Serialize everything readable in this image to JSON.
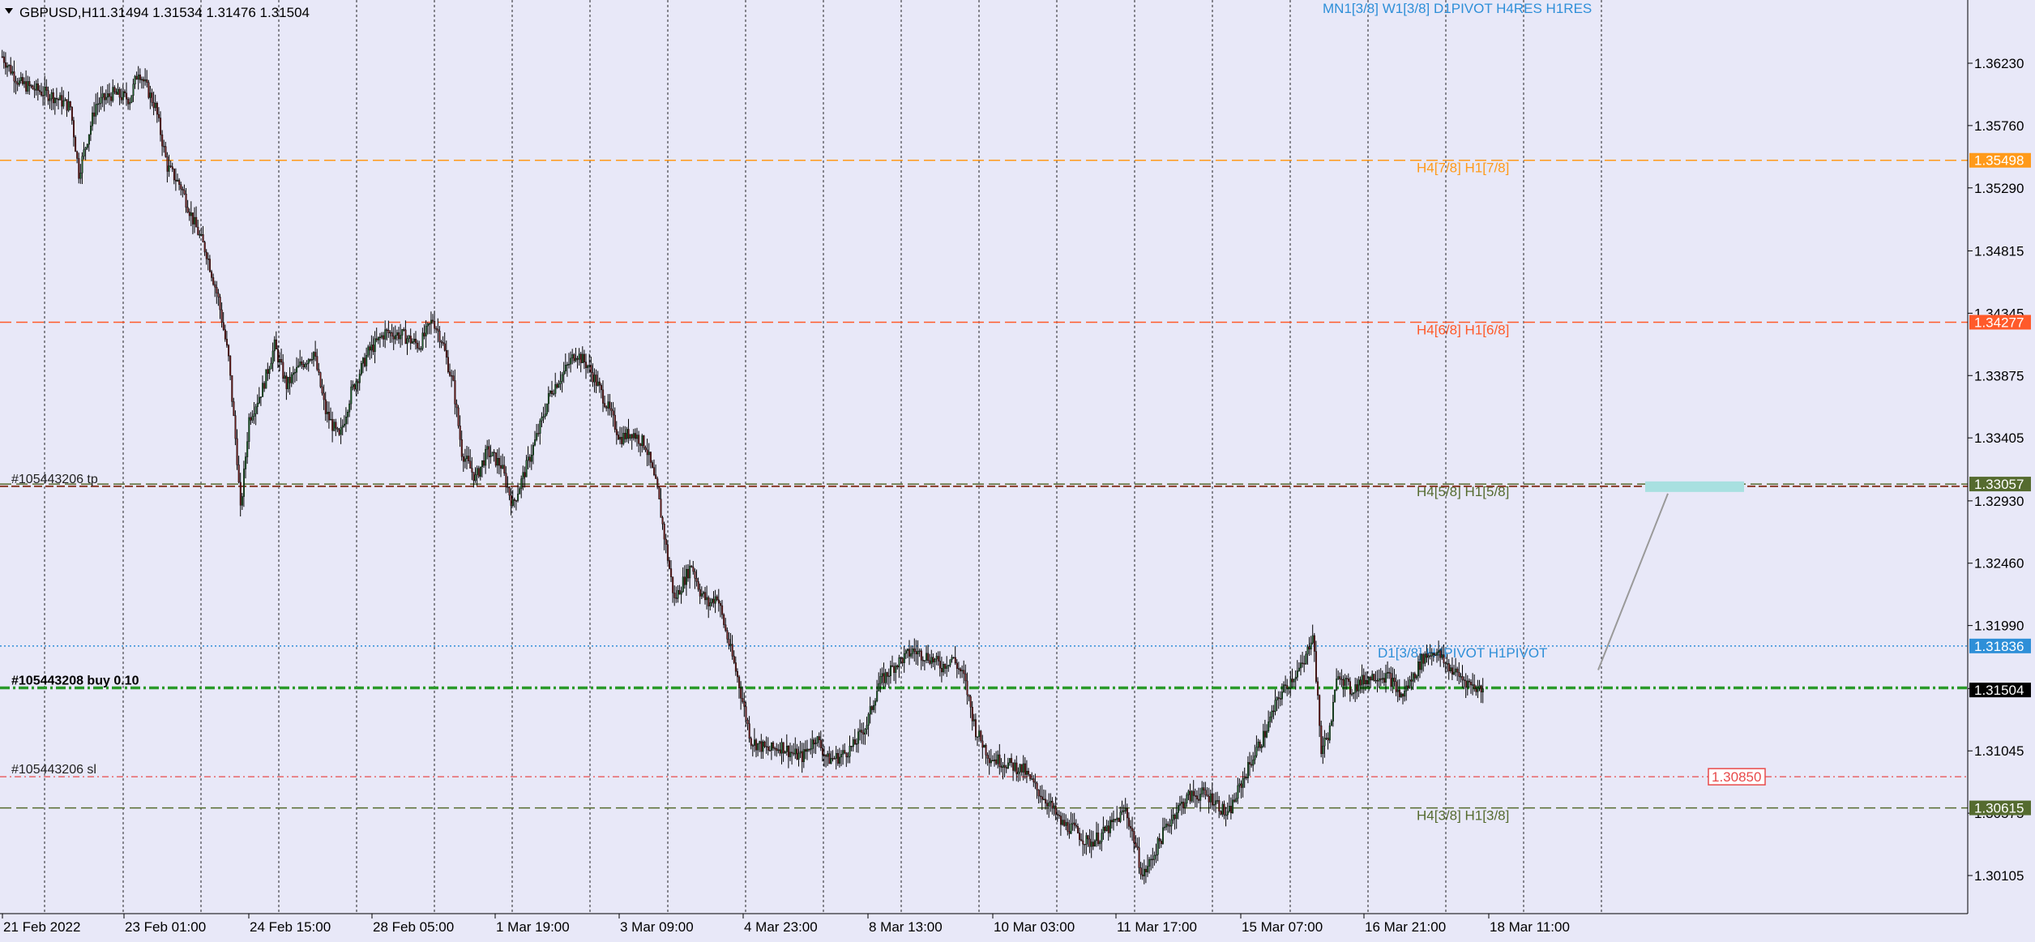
{
  "header": {
    "symbol_timeframe": "GBPUSD,H1",
    "ohlc": "1.31494 1.31534 1.31476 1.31504",
    "indicator_status": "MN1[3/8] W1[3/8] D1PIVOT H4RES H1RES"
  },
  "colors": {
    "background": "#e8e8f8",
    "grid": "#000000",
    "candle": "#000000",
    "bull": "#1e5f2a",
    "bear": "#6b1a1a",
    "axis_text": "#000000",
    "indicator_text": "#2e8fd8"
  },
  "chart_data": {
    "type": "candlestick",
    "symbol": "GBPUSD",
    "timeframe": "H1",
    "ylim": [
      1.2995,
      1.3653
    ],
    "y_ticks": [
      "1.36230",
      "1.35760",
      "1.35290",
      "1.34815",
      "1.34345",
      "1.33875",
      "1.33405",
      "1.32930",
      "1.32460",
      "1.31990",
      "1.31515",
      "1.31045",
      "1.30575",
      "1.30105"
    ],
    "x_ticks": [
      "21 Feb 2022",
      "23 Feb 01:00",
      "24 Feb 15:00",
      "28 Feb 05:00",
      "1 Mar 19:00",
      "3 Mar 09:00",
      "4 Mar 23:00",
      "8 Mar 13:00",
      "10 Mar 03:00",
      "11 Mar 17:00",
      "15 Mar 07:00",
      "16 Mar 21:00",
      "18 Mar 11:00"
    ],
    "price_path": [
      [
        0,
        1.3628
      ],
      [
        10,
        1.3608
      ],
      [
        20,
        1.3603
      ],
      [
        30,
        1.3598
      ],
      [
        40,
        1.359
      ],
      [
        45,
        1.354
      ],
      [
        55,
        1.3592
      ],
      [
        65,
        1.36
      ],
      [
        75,
        1.3596
      ],
      [
        80,
        1.3618
      ],
      [
        90,
        1.359
      ],
      [
        97,
        1.3545
      ],
      [
        105,
        1.353
      ],
      [
        112,
        1.3505
      ],
      [
        120,
        1.348
      ],
      [
        127,
        1.3445
      ],
      [
        133,
        1.34
      ],
      [
        138,
        1.3325
      ],
      [
        140,
        1.3285
      ],
      [
        145,
        1.3355
      ],
      [
        153,
        1.3378
      ],
      [
        160,
        1.341
      ],
      [
        167,
        1.338
      ],
      [
        175,
        1.3395
      ],
      [
        183,
        1.3405
      ],
      [
        190,
        1.336
      ],
      [
        198,
        1.334
      ],
      [
        205,
        1.3375
      ],
      [
        215,
        1.3405
      ],
      [
        225,
        1.342
      ],
      [
        235,
        1.3418
      ],
      [
        245,
        1.341
      ],
      [
        253,
        1.343
      ],
      [
        258,
        1.3415
      ],
      [
        265,
        1.338
      ],
      [
        270,
        1.333
      ],
      [
        278,
        1.331
      ],
      [
        285,
        1.333
      ],
      [
        293,
        1.332
      ],
      [
        300,
        1.329
      ],
      [
        307,
        1.3315
      ],
      [
        315,
        1.3345
      ],
      [
        322,
        1.3375
      ],
      [
        330,
        1.339
      ],
      [
        337,
        1.3405
      ],
      [
        344,
        1.3395
      ],
      [
        350,
        1.338
      ],
      [
        357,
        1.336
      ],
      [
        363,
        1.334
      ],
      [
        370,
        1.3345
      ],
      [
        378,
        1.3335
      ],
      [
        385,
        1.33
      ],
      [
        390,
        1.3258
      ],
      [
        395,
        1.3218
      ],
      [
        400,
        1.3232
      ],
      [
        405,
        1.3245
      ],
      [
        410,
        1.3225
      ],
      [
        415,
        1.3215
      ],
      [
        420,
        1.3222
      ],
      [
        425,
        1.3195
      ],
      [
        432,
        1.316
      ],
      [
        440,
        1.3112
      ],
      [
        450,
        1.3105
      ],
      [
        458,
        1.3108
      ],
      [
        465,
        1.3102
      ],
      [
        470,
        1.31
      ],
      [
        478,
        1.3115
      ],
      [
        485,
        1.3098
      ],
      [
        492,
        1.31
      ],
      [
        500,
        1.3108
      ],
      [
        508,
        1.3125
      ],
      [
        515,
        1.3155
      ],
      [
        525,
        1.317
      ],
      [
        535,
        1.318
      ],
      [
        545,
        1.3175
      ],
      [
        552,
        1.3168
      ],
      [
        558,
        1.3175
      ],
      [
        565,
        1.316
      ],
      [
        572,
        1.312
      ],
      [
        580,
        1.31
      ],
      [
        590,
        1.3095
      ],
      [
        600,
        1.309
      ],
      [
        608,
        1.3075
      ],
      [
        615,
        1.3065
      ],
      [
        622,
        1.305
      ],
      [
        630,
        1.3045
      ],
      [
        638,
        1.3035
      ],
      [
        645,
        1.304
      ],
      [
        653,
        1.305
      ],
      [
        660,
        1.306
      ],
      [
        665,
        1.3038
      ],
      [
        670,
        1.301
      ],
      [
        675,
        1.3022
      ],
      [
        683,
        1.3045
      ],
      [
        690,
        1.306
      ],
      [
        697,
        1.307
      ],
      [
        705,
        1.3072
      ],
      [
        712,
        1.3068
      ],
      [
        720,
        1.3055
      ],
      [
        728,
        1.308
      ],
      [
        735,
        1.31
      ],
      [
        742,
        1.3118
      ],
      [
        750,
        1.3145
      ],
      [
        758,
        1.316
      ],
      [
        765,
        1.317
      ],
      [
        770,
        1.3195
      ],
      [
        772,
        1.316
      ],
      [
        775,
        1.3105
      ],
      [
        780,
        1.312
      ],
      [
        785,
        1.3165
      ],
      [
        792,
        1.315
      ],
      [
        800,
        1.3158
      ],
      [
        808,
        1.3162
      ],
      [
        815,
        1.316
      ],
      [
        822,
        1.3145
      ],
      [
        828,
        1.3158
      ],
      [
        835,
        1.3175
      ],
      [
        842,
        1.318
      ],
      [
        848,
        1.317
      ],
      [
        855,
        1.3162
      ],
      [
        862,
        1.3155
      ],
      [
        870,
        1.315
      ]
    ],
    "horizontal_levels": [
      {
        "price": 1.35498,
        "label": "H4[7/8] H1[7/8]",
        "axis_label": "1.35498",
        "color": "#ff9a1a",
        "style": "dash"
      },
      {
        "price": 1.34277,
        "label": "H4[6/8] H1[6/8]",
        "axis_label": "1.34277",
        "color": "#ff5a2a",
        "style": "dash"
      },
      {
        "price": 1.33057,
        "label": "H4[5/8] H1[5/8]",
        "axis_label": "1.33057",
        "color": "#556b2f",
        "style": "dash"
      },
      {
        "price": 1.31836,
        "label": "D1[3/8] H4PIVOT H1PIVOT",
        "axis_label": "1.31836",
        "color": "#2e8fd8",
        "style": "dot"
      },
      {
        "price": 1.30615,
        "label": "H4[3/8] H1[3/8]",
        "axis_label": "1.30615",
        "color": "#556b2f",
        "style": "dash"
      }
    ],
    "tp_level": {
      "price": 1.3304,
      "label": "#105443206 tp",
      "color": "#8b3a2a"
    },
    "sl_level": {
      "price": 1.3085,
      "label": "#105443206 sl",
      "axis_label": "1.30850",
      "color": "#e84a4a"
    },
    "order_level": {
      "price": 1.3152,
      "label": "#105443208 buy 0.10",
      "color": "#2a9a2a"
    },
    "bid": {
      "price": 1.31504,
      "label": "1.31504"
    }
  }
}
